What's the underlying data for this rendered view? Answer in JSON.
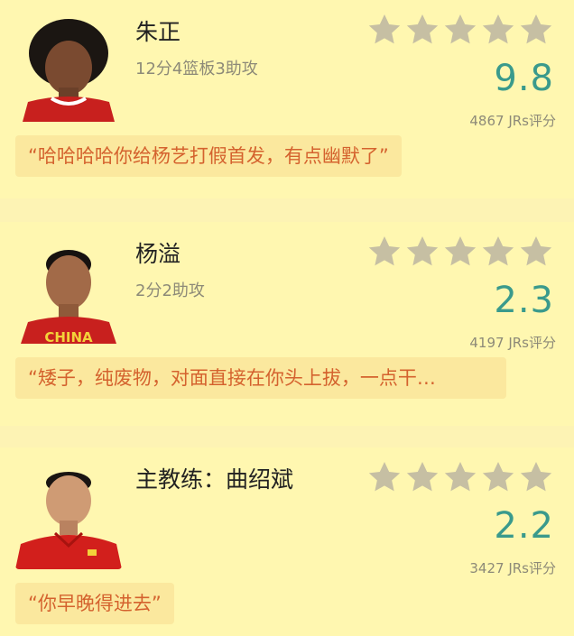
{
  "colors": {
    "background": "#fdf3b4",
    "card": "#fff7b0",
    "score": "#3a9a8c",
    "quote_text": "#d4622e",
    "quote_bg": "#fbe89e",
    "star_empty": "#c6bfa3"
  },
  "cards": [
    {
      "name": "朱正",
      "stat": "12分4篮板3助攻",
      "rating_stars": 0,
      "score": "9.8",
      "votes": "4867 JRs评分",
      "quote": "“哈哈哈哈你给杨艺打假首发，有点幽默了”"
    },
    {
      "name": "杨溢",
      "stat": "2分2助攻",
      "rating_stars": 0,
      "score": "2.3",
      "votes": "4197 JRs评分",
      "quote": "“矮子，纯废物，对面直接在你头上拔，一点干…"
    },
    {
      "name": "主教练：曲绍斌",
      "stat": "",
      "rating_stars": 0,
      "score": "2.2",
      "votes": "3427 JRs评分",
      "quote": "“你早晚得进去”"
    }
  ]
}
